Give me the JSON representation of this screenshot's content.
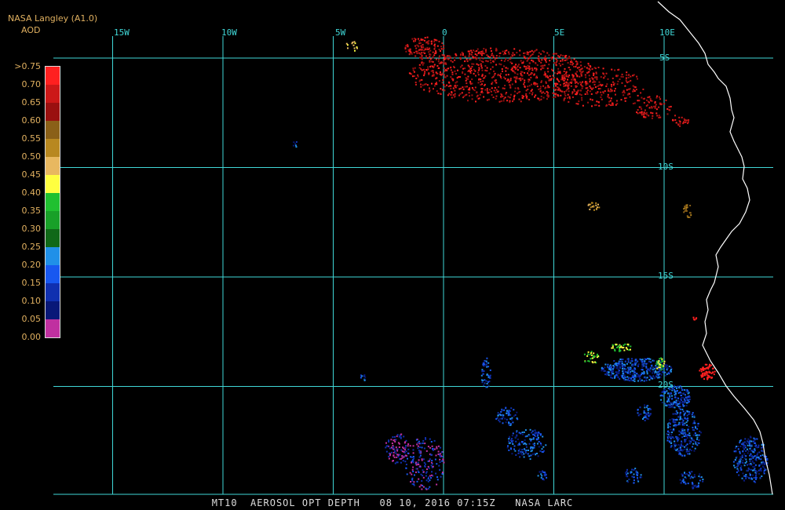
{
  "header": {
    "source": "NASA Langley (A1.0)",
    "product": "AOD"
  },
  "map": {
    "region": "South-east Atlantic / Angola-Namibia coast",
    "lon_labels": [
      "15W",
      "10W",
      "5W",
      "0",
      "5E",
      "10E"
    ],
    "lon_values": [
      -15,
      -10,
      -5,
      0,
      5,
      10
    ],
    "lat_labels": [
      "5S",
      "10S",
      "15S",
      "20S"
    ],
    "lat_values": [
      -5,
      -10,
      -15,
      -20
    ]
  },
  "legend": {
    "labels": [
      ">0.75",
      "0.70",
      "0.65",
      "0.60",
      "0.55",
      "0.50",
      "0.45",
      "0.40",
      "0.35",
      "0.30",
      "0.25",
      "0.20",
      "0.15",
      "0.10",
      "0.05",
      "0.00"
    ],
    "colors": [
      "#ff2020",
      "#cc1818",
      "#9a1010",
      "#8a6018",
      "#b88820",
      "#e8b860",
      "#ffff40",
      "#20c030",
      "#18a028",
      "#106818",
      "#2090e8",
      "#1858f0",
      "#1030b0",
      "#081878",
      "#c030a0"
    ]
  },
  "colors": {
    "grid": "#40d8d8",
    "coast": "#ffffff",
    "header_text": "#e0b060"
  },
  "footer": {
    "text": "MT10  AEROSOL OPT DEPTH   08 10, 2016 07:15Z   NASA LARC"
  }
}
